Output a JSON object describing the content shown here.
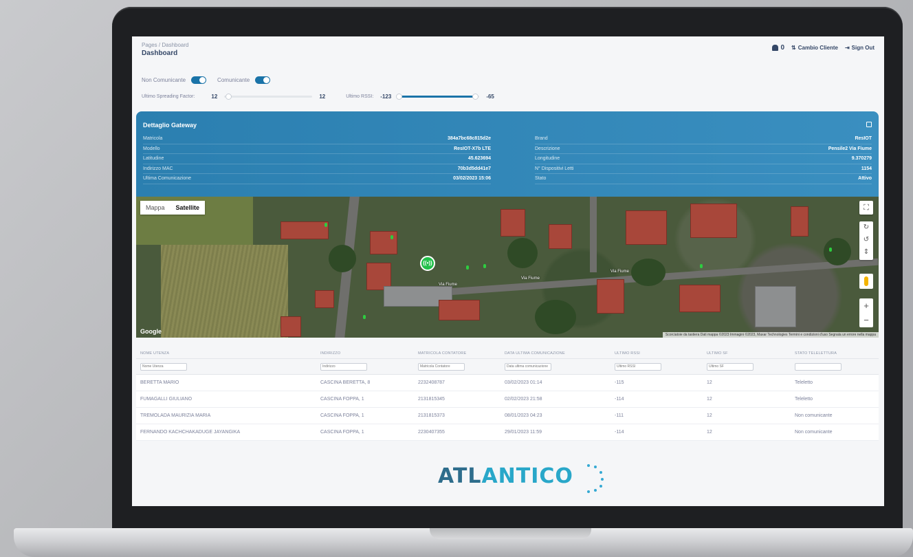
{
  "header": {
    "breadcrumb": "Pages / Dashboard",
    "title": "Dashboard",
    "notification_count": "0",
    "cambio_cliente": "Cambio Cliente",
    "sign_out": "Sign Out"
  },
  "filters": {
    "non_comunicante_label": "Non Comunicante",
    "comunicante_label": "Comunicante",
    "spreading_factor_label": "Ultimo Spreading Factor:",
    "sf_min": "12",
    "sf_max": "12",
    "rssi_label": "Ultimo RSSI:",
    "rssi_min": "-123",
    "rssi_max": "-65"
  },
  "gateway": {
    "title": "Dettaglio Gateway",
    "left": [
      {
        "label": "Matricola",
        "value": "384a7bc68c815d2e"
      },
      {
        "label": "Modello",
        "value": "ResIOT-X7b LTE"
      },
      {
        "label": "Latitudine",
        "value": "45.623694"
      },
      {
        "label": "Indirizzo MAC",
        "value": "70b3d5dd41e7"
      },
      {
        "label": "Ultima Comunicazione",
        "value": "03/02/2023 15:06"
      }
    ],
    "right": [
      {
        "label": "Brand",
        "value": "ResIOT"
      },
      {
        "label": "Descrizione",
        "value": "Pensile2 Via Fiume"
      },
      {
        "label": "Longitudine",
        "value": "9.370279"
      },
      {
        "label": "N° Dispositivi Letti",
        "value": "1154"
      },
      {
        "label": "Stato",
        "value": "Attivo"
      }
    ]
  },
  "map": {
    "tab_map": "Mappa",
    "tab_satellite": "Satellite",
    "google": "Google",
    "attribution": "Scorciatoie da tastiera   Dati mappa ©2023 Immagini ©2023, Maxar Technologies   Termini e condizioni d'uso   Segnala un errore nella mappa",
    "streets": [
      "Via Fiume",
      "Via Fiume",
      "Via Fiume"
    ]
  },
  "table": {
    "columns": [
      "Nome Utenza",
      "Indirizzo",
      "Matricola Contatore",
      "Data Ultima Comunicazione",
      "Ultimo RSSI",
      "Ultimo SF",
      "Stato Telelettura"
    ],
    "filter_placeholders": [
      "Nome Utenza",
      "Indirizzo",
      "Matricola Contatore",
      "Data ultima comunicazione",
      "Ultimo RSSI",
      "Ultimo SF",
      ""
    ],
    "rows": [
      [
        "BERETTA MARIO",
        "CASCINA BERETTA, 8",
        "2232408787",
        "03/02/2023 01:14",
        "-115",
        "12",
        "Teleletto"
      ],
      [
        "FUMAGALLI GIULIANO",
        "CASCINA FOPPA, 1",
        "2131815345",
        "02/02/2023 21:58",
        "-114",
        "12",
        "Teleletto"
      ],
      [
        "TREMOLADA MAURIZIA MARIA",
        "CASCINA FOPPA, 1",
        "2131815373",
        "08/01/2023 04:23",
        "-111",
        "12",
        "Non comunicante"
      ],
      [
        "FERNANDO KACHCHAKADUGE JAYANGIKA",
        "CASCINA FOPPA, 1",
        "2230407355",
        "29/01/2023 11:59",
        "-114",
        "12",
        "Non comunicante"
      ]
    ]
  },
  "logo": {
    "part1": "ATL",
    "part2": "ANTICO"
  }
}
